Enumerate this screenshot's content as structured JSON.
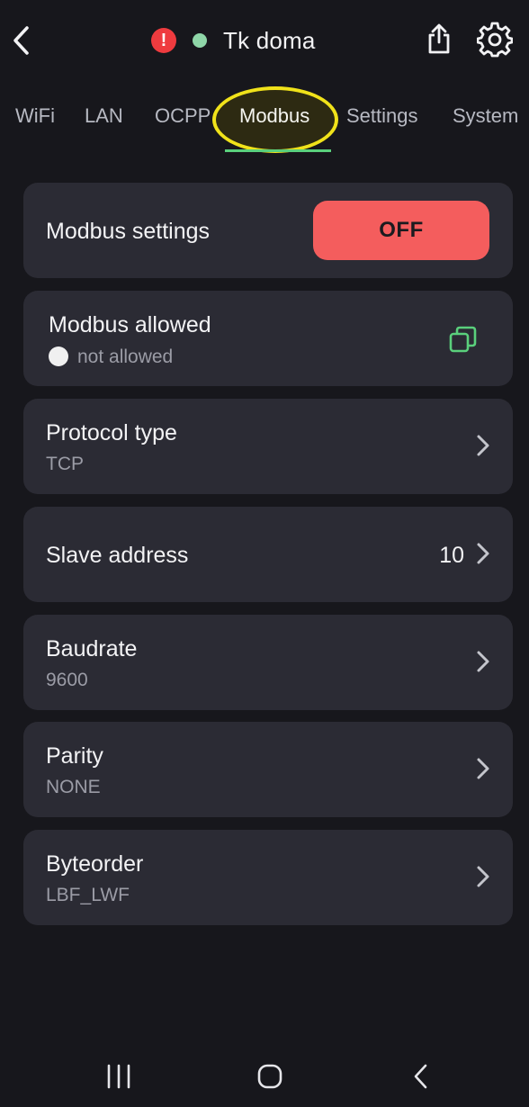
{
  "header": {
    "title": "Tk doma",
    "alert_symbol": "!",
    "back_icon": "chevron-left-icon",
    "share_icon": "share-icon",
    "settings_icon": "gear-icon",
    "status_color": "#8fd6a8",
    "alert_color": "#ef3b3f"
  },
  "tabs": [
    {
      "label": "WiFi"
    },
    {
      "label": "LAN"
    },
    {
      "label": "OCPP"
    },
    {
      "label": "Modbus",
      "active": true
    },
    {
      "label": "Settings"
    },
    {
      "label": "System"
    }
  ],
  "modbus_settings": {
    "label": "Modbus settings",
    "toggle_label": "OFF"
  },
  "modbus_allowed": {
    "label": "Modbus allowed",
    "status": "not allowed",
    "icon": "copy-icon"
  },
  "protocol_type": {
    "label": "Protocol type",
    "value": "TCP"
  },
  "slave_address": {
    "label": "Slave address",
    "value": "10"
  },
  "baudrate": {
    "label": "Baudrate",
    "value": "9600"
  },
  "parity": {
    "label": "Parity",
    "value": "NONE"
  },
  "byteorder": {
    "label": "Byteorder",
    "value": "LBF_LWF"
  },
  "navbar": {
    "recents_icon": "recents-icon",
    "home_icon": "home-icon",
    "back_icon": "back-icon"
  },
  "colors": {
    "background": "#17171c",
    "card": "#2b2b34",
    "accent_green": "#5ad07c",
    "toggle_off": "#f45d5d",
    "highlight": "#f0e21a"
  }
}
